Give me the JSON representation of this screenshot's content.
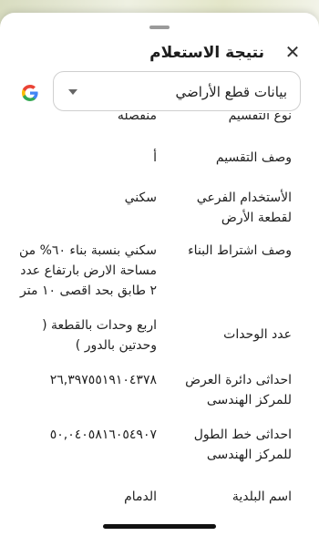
{
  "header": {
    "title": "نتيجة الاستعلام",
    "close_icon": "close-icon"
  },
  "selector": {
    "value": "بيانات قطع الأراضي",
    "arrow_icon": "chevron-down-icon"
  },
  "google_icon": "google-logo-icon",
  "rows": [
    {
      "label": "نوع التقسيم",
      "value": "منفصله"
    },
    {
      "label": "وصف التقسيم",
      "value": "أ"
    },
    {
      "label": "الأستخدام الفرعي لقطعة الأرض",
      "value": "سكني"
    },
    {
      "label": "وصف اشتراط البناء",
      "value": "سكني بنسبة بناء ٦٠% من مساحة الارض بارتفاع عدد ٢ طابق بحد اقصى ١٠ متر"
    },
    {
      "label": "عدد الوحدات",
      "value": "اربع وحدات بالقطعة ( وحدتين بالدور )"
    },
    {
      "label": "احداثى دائرة العرض للمركز الهندسى",
      "value": "٢٦,٣٩٧٥٥١٩١٠٤٣٧٨"
    },
    {
      "label": "احداثى خط الطول للمركز الهندسى",
      "value": "٥٠,٠٤٠٥٨١٦٠٥٤٩٠٧"
    },
    {
      "label": "اسم البلدية",
      "value": "الدمام"
    }
  ]
}
